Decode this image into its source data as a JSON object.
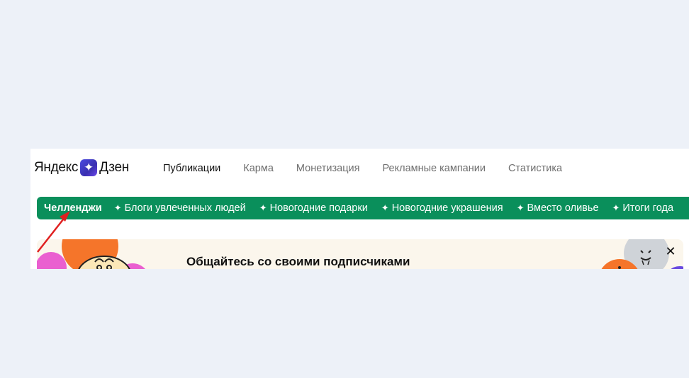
{
  "header": {
    "logo_left": "Яндекс",
    "logo_right": "Дзен",
    "nav": [
      {
        "label": "Публикации",
        "active": true
      },
      {
        "label": "Карма",
        "active": false
      },
      {
        "label": "Монетизация",
        "active": false
      },
      {
        "label": "Рекламные кампании",
        "active": false
      },
      {
        "label": "Статистика",
        "active": false
      }
    ]
  },
  "challenges": {
    "title": "Челленджи",
    "star_glyph": "✦",
    "items": [
      "Блоги увлеченных людей",
      "Новогодние подарки",
      "Новогодние украшения",
      "Вместо оливье",
      "Итоги года"
    ],
    "color": "#0a8f5b"
  },
  "banner": {
    "title": "Общайтесь со своими подписчиками",
    "close_icon": "close-icon",
    "close_glyph": "✕"
  },
  "annotation": {
    "arrow_color": "#e02020"
  }
}
